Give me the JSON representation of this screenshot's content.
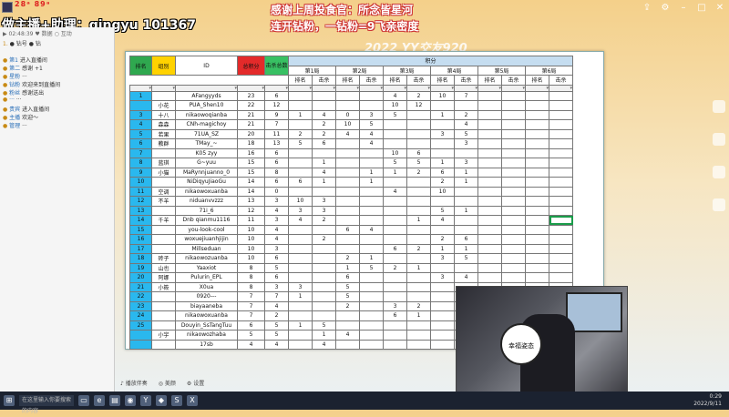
{
  "header": {
    "streamer_text": "做主播+助理：qingyu 101367",
    "stats_text": "28ᵃ 89ᵃ",
    "banner_line1": "感谢上周投食官：所念皆星河",
    "banner_line2": "连开钻粉，一钻粉=9飞亲密度",
    "event_title": "2022 YY交友920"
  },
  "chat": {
    "head": "▶ 02:48:39  ♥ 数据   ○ 互动",
    "lines": [
      {
        "lvl": "1.",
        "usr": "",
        "text": "● 钻号 ● 钻"
      },
      {
        "lvl": "",
        "usr": "",
        "text": ""
      },
      {
        "lvl": "●",
        "usr": "第1",
        "text": "进入直播间"
      },
      {
        "lvl": "●",
        "usr": "第二",
        "text": "感谢 +1"
      },
      {
        "lvl": "●",
        "usr": "星粉",
        "text": "···"
      },
      {
        "lvl": "●",
        "usr": "钻粉",
        "text": "欢迎来到直播间"
      },
      {
        "lvl": "●",
        "usr": "粉丝",
        "text": "感谢送出"
      },
      {
        "lvl": "●",
        "usr": "···",
        "text": "···"
      },
      {
        "lvl": "●",
        "usr": "贵宾",
        "text": "进入直播间"
      },
      {
        "lvl": "●",
        "usr": "主播",
        "text": "欢迎～"
      },
      {
        "lvl": "●",
        "usr": "管理",
        "text": "···"
      }
    ]
  },
  "sheet": {
    "headers": {
      "rank": "排名",
      "group": "组别",
      "id": "ID",
      "score": "总积分",
      "kills": "击杀总数",
      "points": "积分",
      "rounds": [
        "第1局",
        "第2局",
        "第3局",
        "第4局",
        "第5局",
        "第6局"
      ],
      "sub": [
        "排名",
        "击杀"
      ]
    },
    "rows": [
      {
        "rank": "1",
        "group": "",
        "id": "AFangyyds",
        "score": "23",
        "kills": "6",
        "r": [
          "",
          "",
          "",
          "",
          "4",
          "2",
          "10",
          "7",
          "",
          "",
          "",
          ""
        ]
      },
      {
        "rank": "",
        "group": "小花",
        "id": "PUA_Shen10",
        "score": "22",
        "kills": "12",
        "r": [
          "",
          "",
          "",
          "",
          "10",
          "12",
          "",
          "",
          "",
          "",
          "",
          ""
        ]
      },
      {
        "rank": "3",
        "group": "十八",
        "id": "nikaowoqianba",
        "score": "21",
        "kills": "9",
        "r": [
          "1",
          "4",
          "0",
          "3",
          "5",
          "",
          "1",
          "2",
          "",
          "",
          "",
          ""
        ]
      },
      {
        "rank": "4",
        "group": "森森",
        "id": "CNh-magichoy",
        "score": "21",
        "kills": "7",
        "r": [
          "",
          "2",
          "10",
          "5",
          "",
          "",
          "",
          "4",
          "",
          "",
          "",
          ""
        ]
      },
      {
        "rank": "5",
        "group": "若果",
        "id": "71UA_SZ",
        "score": "20",
        "kills": "11",
        "r": [
          "2",
          "2",
          "4",
          "4",
          "",
          "",
          "3",
          "5",
          "",
          "",
          "",
          ""
        ]
      },
      {
        "rank": "6",
        "group": "教群",
        "id": "TMay_~",
        "score": "18",
        "kills": "13",
        "r": [
          "5",
          "6",
          "",
          "4",
          "",
          "",
          "",
          "3",
          "",
          "",
          "",
          ""
        ]
      },
      {
        "rank": "7",
        "group": "",
        "id": "K05 zyy",
        "score": "16",
        "kills": "6",
        "r": [
          "",
          "",
          "",
          "",
          "10",
          "6",
          "",
          "",
          "",
          "",
          "",
          ""
        ]
      },
      {
        "rank": "8",
        "group": "蓝琪",
        "id": "G~yuu",
        "score": "15",
        "kills": "6",
        "r": [
          "",
          "1",
          "",
          "",
          "5",
          "5",
          "1",
          "3",
          "",
          "",
          "",
          ""
        ]
      },
      {
        "rank": "9",
        "group": "小猫",
        "id": "MaRynnjuanno_0",
        "score": "15",
        "kills": "8",
        "r": [
          "",
          "4",
          "",
          "1",
          "1",
          "2",
          "6",
          "1",
          "",
          "",
          "",
          ""
        ]
      },
      {
        "rank": "10",
        "group": "",
        "id": "NiDiqyuJiaoGu",
        "score": "14",
        "kills": "6",
        "r": [
          "6",
          "1",
          "",
          "1",
          "",
          "",
          "2",
          "1",
          "",
          "",
          "",
          ""
        ]
      },
      {
        "rank": "11",
        "group": "空调",
        "id": "nikaowoxuanba",
        "score": "14",
        "kills": "0",
        "r": [
          "",
          "",
          "",
          "",
          "4",
          "",
          "10",
          "",
          "",
          "",
          "",
          ""
        ]
      },
      {
        "rank": "12",
        "group": "不羊",
        "id": "niduanvvzzz",
        "score": "13",
        "kills": "3",
        "r": [
          "10",
          "3",
          "",
          "",
          "",
          "",
          "",
          "",
          "",
          "",
          "",
          ""
        ]
      },
      {
        "rank": "13",
        "group": "",
        "id": "71i_6",
        "score": "12",
        "kills": "4",
        "r": [
          "3",
          "3",
          "",
          "",
          "",
          "",
          "5",
          "1",
          "",
          "",
          "",
          ""
        ]
      },
      {
        "rank": "14",
        "group": "千羊",
        "id": "Dnb qianmu1116",
        "score": "11",
        "kills": "3",
        "r": [
          "4",
          "2",
          "",
          "",
          "",
          "1",
          "4",
          "",
          "",
          "",
          "",
          ""
        ]
      },
      {
        "rank": "15",
        "group": "",
        "id": "you-look-cool",
        "score": "10",
        "kills": "4",
        "r": [
          "",
          "",
          "6",
          "4",
          "",
          "",
          "",
          "",
          "",
          "",
          "",
          ""
        ]
      },
      {
        "rank": "16",
        "group": "",
        "id": "woxuejiuanhjijin",
        "score": "10",
        "kills": "4",
        "r": [
          "",
          "2",
          "",
          "",
          "",
          "",
          "2",
          "6",
          "",
          "",
          "",
          ""
        ]
      },
      {
        "rank": "17",
        "group": "",
        "id": "Millseduan",
        "score": "10",
        "kills": "3",
        "r": [
          "",
          "",
          "",
          "",
          "6",
          "2",
          "1",
          "1",
          "",
          "",
          "",
          ""
        ]
      },
      {
        "rank": "18",
        "group": "砖子",
        "id": "nikaowozuanba",
        "score": "10",
        "kills": "6",
        "r": [
          "",
          "",
          "2",
          "1",
          "",
          "",
          "3",
          "5",
          "",
          "",
          "",
          ""
        ]
      },
      {
        "rank": "19",
        "group": "山也",
        "id": "Yaaxiot",
        "score": "8",
        "kills": "5",
        "r": [
          "",
          "",
          "1",
          "5",
          "2",
          "1",
          "",
          "",
          "",
          "",
          "",
          ""
        ]
      },
      {
        "rank": "20",
        "group": "阿娜",
        "id": "Pulurin_EPL",
        "score": "8",
        "kills": "6",
        "r": [
          "",
          "",
          "6",
          "",
          "",
          "",
          "3",
          "4",
          "",
          "",
          "",
          ""
        ]
      },
      {
        "rank": "21",
        "group": "小筱",
        "id": "X0ua",
        "score": "8",
        "kills": "3",
        "r": [
          "3",
          "",
          "5",
          "",
          "",
          "",
          "",
          "",
          "",
          "",
          "",
          ""
        ]
      },
      {
        "rank": "22",
        "group": "",
        "id": "0920---",
        "score": "7",
        "kills": "7",
        "r": [
          "1",
          "",
          "5",
          "",
          "",
          "",
          "",
          "",
          "",
          "",
          "",
          ""
        ]
      },
      {
        "rank": "23",
        "group": "",
        "id": "biayaaneba",
        "score": "7",
        "kills": "4",
        "r": [
          "",
          "",
          "2",
          "",
          "3",
          "2",
          "",
          "",
          "",
          "",
          "",
          ""
        ]
      },
      {
        "rank": "24",
        "group": "",
        "id": "nikaowoxuanba",
        "score": "7",
        "kills": "2",
        "r": [
          "",
          "",
          "",
          "",
          "6",
          "1",
          "",
          "",
          "",
          "",
          "",
          ""
        ]
      },
      {
        "rank": "25",
        "group": "",
        "id": "Douyin_SsTangTuu",
        "score": "6",
        "kills": "5",
        "r": [
          "1",
          "5",
          "",
          "",
          "",
          "",
          "",
          "",
          "",
          "",
          "",
          ""
        ]
      },
      {
        "rank": "",
        "group": "小宇",
        "id": "nikaowozhaba",
        "score": "5",
        "kills": "5",
        "r": [
          "",
          "1",
          "4",
          "",
          "",
          "",
          "",
          "",
          "",
          "",
          "",
          ""
        ]
      },
      {
        "rank": "",
        "group": "",
        "id": "17sb",
        "score": "4",
        "kills": "4",
        "r": [
          "",
          "4",
          "",
          "",
          "",
          "",
          "",
          "",
          "",
          "",
          "",
          ""
        ]
      }
    ]
  },
  "cam": {
    "sign_text": "幸福姿态"
  },
  "bottombar": {
    "items": [
      "♪ 播放伴奏",
      "◎ 美颜",
      "⚙ 设置"
    ]
  },
  "taskbar": {
    "search_placeholder": "在这里输入你要搜索的内容",
    "time": "0:29",
    "date": "2022/9/11"
  },
  "colors": {
    "rank_header": "#2fa84f",
    "group_header": "#ffd200",
    "score_header": "#e32a2a",
    "kills_header": "#38c063",
    "rank_cell": "#2ab8ee"
  }
}
